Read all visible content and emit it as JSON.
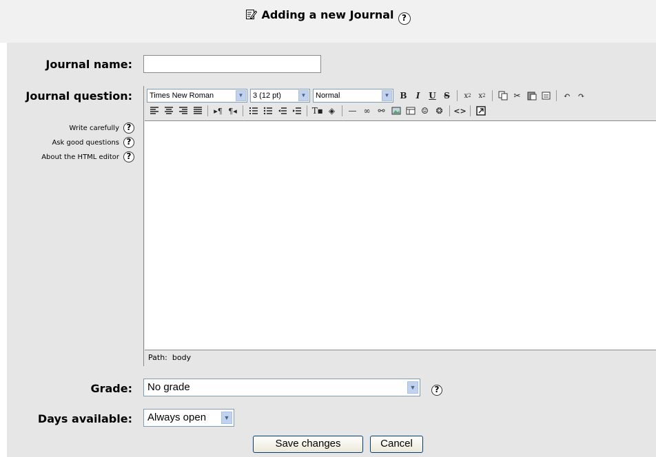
{
  "page": {
    "heading": "Adding a new Journal",
    "heading_icon": "edit-document-icon",
    "heading_help_icon": "help-icon"
  },
  "form": {
    "journal_name": {
      "label": "Journal name:",
      "value": ""
    },
    "journal_question": {
      "label": "Journal question:",
      "help_links": [
        "Write carefully",
        "Ask good questions",
        "About the HTML editor"
      ]
    },
    "editor": {
      "font_select": "Times New Roman",
      "size_select": "3 (12 pt)",
      "format_select": "Normal",
      "row1_icons": [
        "bold-icon",
        "italic-icon",
        "underline-icon",
        "strikethrough-icon",
        "subscript-icon",
        "superscript-icon",
        "copy-icon",
        "cut-icon",
        "paste-icon",
        "clean-word-icon",
        "undo-icon",
        "redo-icon"
      ],
      "row2_icons": [
        "align-left-icon",
        "align-center-icon",
        "align-right-icon",
        "align-justify-icon",
        "ltr-icon",
        "rtl-icon",
        "ordered-list-icon",
        "unordered-list-icon",
        "outdent-icon",
        "indent-icon",
        "text-color-icon",
        "background-color-icon",
        "horizontal-rule-icon",
        "link-icon",
        "unlink-icon",
        "image-icon",
        "table-icon",
        "smiley-icon",
        "special-char-icon",
        "html-source-icon",
        "fullscreen-icon"
      ],
      "path_label": "Path:",
      "path_value": "body"
    },
    "grade": {
      "label": "Grade:",
      "value": "No grade"
    },
    "days_available": {
      "label": "Days available:",
      "value": "Always open"
    }
  },
  "buttons": {
    "save": "Save changes",
    "cancel": "Cancel"
  }
}
